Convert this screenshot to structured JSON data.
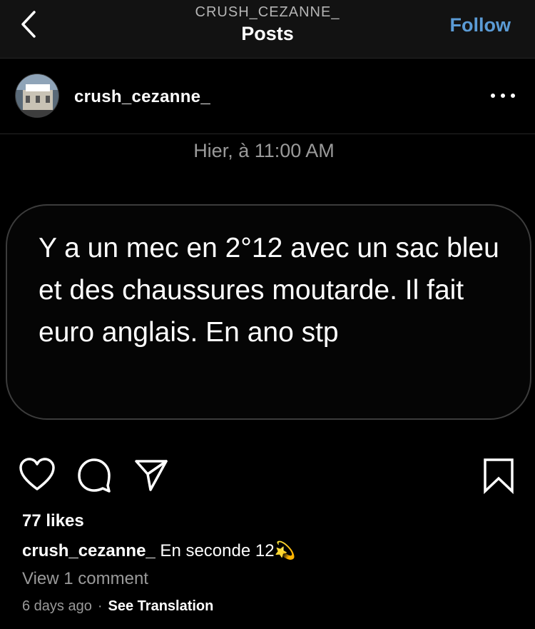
{
  "header": {
    "account": "CRUSH_CEZANNE_",
    "title": "Posts",
    "follow_label": "Follow",
    "back_icon": "chevron-left-icon"
  },
  "post": {
    "username": "crush_cezanne_",
    "more_icon": "more-dots-icon",
    "timestamp": "Hier, à 11:00 AM",
    "message": "Y a un mec en 2°12 avec un sac bleu et des chaussures moutarde. Il fait euro anglais. En ano stp",
    "likes": "77 likes",
    "caption_user": "crush_cezanne_",
    "caption_text": " En seconde 12💫",
    "view_comments": "View 1 comment",
    "age": "6 days ago",
    "separator": "·",
    "translate_label": "See Translation"
  },
  "icons": {
    "like": "heart-icon",
    "comment": "comment-icon",
    "share": "send-icon",
    "save": "bookmark-icon"
  },
  "colors": {
    "background": "#000000",
    "bar": "#121212",
    "accent": "#5b9bd5",
    "muted": "#9a9a9a"
  }
}
